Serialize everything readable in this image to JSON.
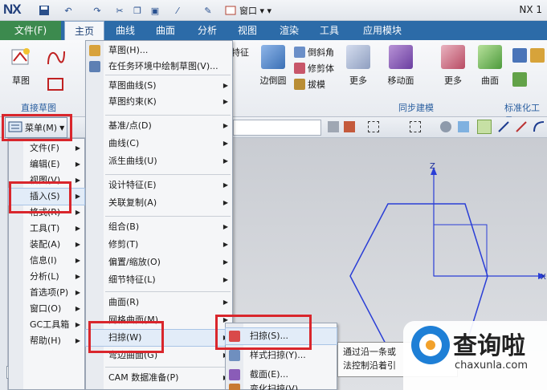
{
  "titlebar": {
    "logo": "NX",
    "window_menu": "窗口",
    "app_title": "NX 1"
  },
  "tabs": [
    "文件(F)",
    "主页",
    "曲线",
    "曲面",
    "分析",
    "视图",
    "渲染",
    "工具",
    "应用模块"
  ],
  "ribbon": {
    "sketch_label": "草图",
    "sketch_group": "直接草图",
    "feature_small": [
      "特征"
    ],
    "edge_blend": "边倒圆",
    "chamfer": "倒斜角",
    "trim_body": "修剪体",
    "draft": "拔模",
    "more1": "更多",
    "move_face": "移动面",
    "more2": "更多",
    "sync_group": "同步建模",
    "surface": "曲面",
    "std_group": "标准化工具"
  },
  "menu_button": "菜单(M)",
  "main_menu": [
    "文件(F)",
    "编辑(E)",
    "视图(V)",
    "插入(S)",
    "格式(R)",
    "工具(T)",
    "装配(A)",
    "信息(I)",
    "分析(L)",
    "首选项(P)",
    "窗口(O)",
    "GC工具箱",
    "帮助(H)"
  ],
  "insert_menu": [
    {
      "label": "草图(H)..."
    },
    {
      "label": "在任务环境中绘制草图(V)..."
    },
    {
      "label": "草图曲线(S)"
    },
    {
      "label": "草图约束(K)"
    },
    {
      "label": "基准/点(D)"
    },
    {
      "label": "曲线(C)"
    },
    {
      "label": "派生曲线(U)"
    },
    {
      "label": "设计特征(E)"
    },
    {
      "label": "关联复制(A)"
    },
    {
      "label": "组合(B)"
    },
    {
      "label": "修剪(T)"
    },
    {
      "label": "偏置/缩放(O)"
    },
    {
      "label": "细节特征(L)"
    },
    {
      "label": "曲面(R)"
    },
    {
      "label": "网格曲面(M)"
    },
    {
      "label": "扫掠(W)"
    },
    {
      "label": "弯边曲面(G)"
    },
    {
      "label": "CAM 数据准备(P)"
    }
  ],
  "sweep_menu": [
    "扫掠(S)...",
    "样式扫掠(Y)...",
    "截面(E)...",
    "变化扫掠(V)..."
  ],
  "tooltip": [
    "通过沿一条或",
    "法控制沿着引"
  ],
  "axes": {
    "z": "Z",
    "x": "X"
  },
  "watermark": {
    "title": "查询啦",
    "url": "chaxunla.com"
  },
  "colors": {
    "tabbar": "#2c6ba8",
    "redbox": "#d9262c",
    "axis": "#2a3ed6"
  }
}
